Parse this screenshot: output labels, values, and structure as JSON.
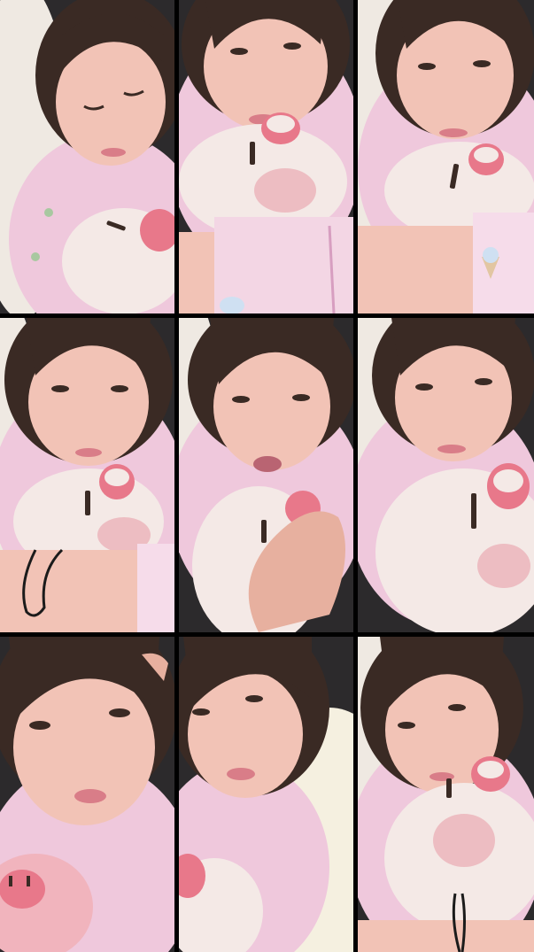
{
  "layout": {
    "rows": 3,
    "columns": 3
  },
  "palette": {
    "skin": "#f2c3b6",
    "skin_shadow": "#e3a597",
    "hair": "#3a2a24",
    "pajama_pink": "#efc8dc",
    "pajama_light": "#f6dcea",
    "plush_white": "#f4e9e6",
    "plush_nose": "#e8788a",
    "pillow": "#efe9e2",
    "background_dark": "#2c2a2c",
    "lips": "#d97d88",
    "cord": "#1b1b1b"
  },
  "frames": [
    {
      "id": 1,
      "variant": "face-down-left-pillow"
    },
    {
      "id": 2,
      "variant": "face-top-plush-arm"
    },
    {
      "id": 3,
      "variant": "face-top-plush-arm"
    },
    {
      "id": 4,
      "variant": "face-plush-arm-cord"
    },
    {
      "id": 5,
      "variant": "face-plush-hand"
    },
    {
      "id": 6,
      "variant": "face-plush-large"
    },
    {
      "id": 7,
      "variant": "face-closeup-plush-bottom"
    },
    {
      "id": 8,
      "variant": "face-tilted-pillow"
    },
    {
      "id": 9,
      "variant": "face-side-glance-plush"
    }
  ]
}
